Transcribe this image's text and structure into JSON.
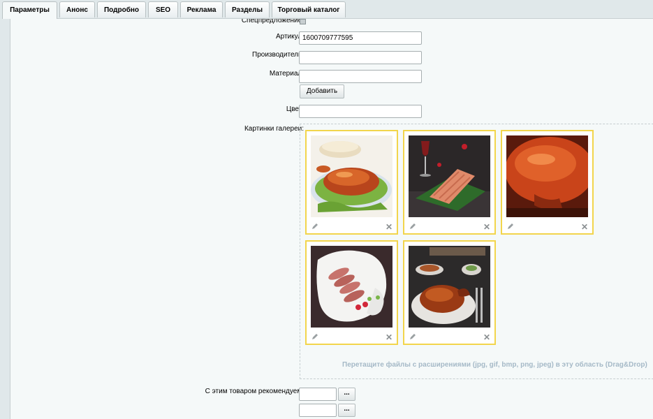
{
  "tabs": [
    {
      "label": "Параметры",
      "active": true
    },
    {
      "label": "Анонс"
    },
    {
      "label": "Подробно"
    },
    {
      "label": "SEO"
    },
    {
      "label": "Реклама"
    },
    {
      "label": "Разделы"
    },
    {
      "label": "Торговый каталог"
    }
  ],
  "form": {
    "special_offer_label": "Спецпредложение:",
    "article_label": "Артикул:",
    "article_value": "1600709777595",
    "manufacturer_label": "Производитель:",
    "manufacturer_value": "",
    "material_label": "Материал:",
    "material_value": "",
    "add_button": "Добавить",
    "color_label": "Цвет:",
    "color_value": "",
    "gallery_label": "Картинки галереи:",
    "dropzone_hint": "Перетащите файлы с расширениями (jpg, gif, bmp, png, jpeg) в эту область (Drag&Drop)",
    "recommend_label": "С этим товаром рекомендуем:",
    "recommend_values": [
      "",
      ""
    ],
    "browse_button": "..."
  },
  "gallery": {
    "delete_symbol": "✕",
    "images": [
      {
        "subject": "roast-duck-on-lettuce-icon"
      },
      {
        "subject": "sliced-duck-with-wine-icon"
      },
      {
        "subject": "roast-duck-closeup-icon"
      },
      {
        "subject": "duck-slices-on-plate-icon"
      },
      {
        "subject": "roast-duck-dinner-table-icon"
      }
    ]
  },
  "colors": {
    "accent_border": "#f2d54c",
    "hint_text": "#a5b9c7"
  }
}
